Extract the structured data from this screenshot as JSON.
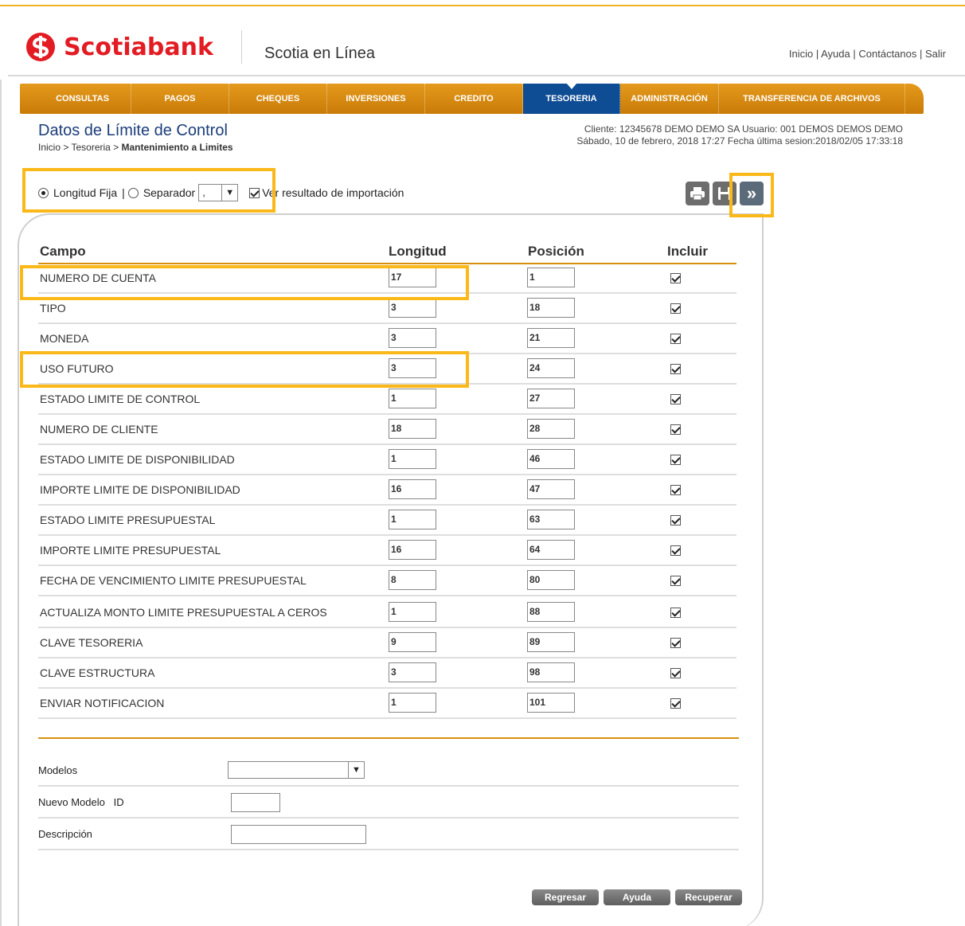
{
  "header": {
    "brand": "Scotiabank",
    "product": "Scotia en Línea",
    "links": [
      "Inicio",
      "Ayuda",
      "Contáctanos",
      "Salir"
    ]
  },
  "nav": {
    "items": [
      "CONSULTAS",
      "PAGOS",
      "CHEQUES",
      "INVERSIONES",
      "CREDITO",
      "TESORERIA",
      "ADMINISTRACIÓN",
      "TRANSFERENCIA DE ARCHIVOS"
    ],
    "active": "TESORERIA"
  },
  "page": {
    "title": "Datos de Límite de Control",
    "breadcrumb_prefix": "Inicio > Tesoreria >",
    "breadcrumb_current": "Mantenimiento a Limites"
  },
  "session": {
    "line1": "Cliente: 12345678 DEMO DEMO SA    Usuario: 001 DEMOS DEMOS DEMO",
    "line2": "Sábado, 10 de febrero, 2018 17:27    Fecha última sesion:2018/02/05 17:33:18"
  },
  "options": {
    "fixed_label": "Longitud Fija",
    "separator_label": "Separador",
    "separator_value": ",",
    "show_result_label": "Ver resultado de importación",
    "fixed_selected": true,
    "show_result_checked": true
  },
  "toolbar": {
    "icons": [
      "print-icon",
      "save-icon",
      "next-icon"
    ]
  },
  "table": {
    "columns": [
      "Campo",
      "Longitud",
      "Posición",
      "Incluir"
    ],
    "rows": [
      {
        "campo": "NUMERO DE CUENTA",
        "longitud": "17",
        "posicion": "1",
        "incluir": true
      },
      {
        "campo": "TIPO",
        "longitud": "3",
        "posicion": "18",
        "incluir": true
      },
      {
        "campo": "MONEDA",
        "longitud": "3",
        "posicion": "21",
        "incluir": true
      },
      {
        "campo": "USO FUTURO",
        "longitud": "3",
        "posicion": "24",
        "incluir": true
      },
      {
        "campo": "ESTADO LIMITE DE CONTROL",
        "longitud": "1",
        "posicion": "27",
        "incluir": true
      },
      {
        "campo": "NUMERO DE CLIENTE",
        "longitud": "18",
        "posicion": "28",
        "incluir": true
      },
      {
        "campo": "ESTADO LIMITE DE DISPONIBILIDAD",
        "longitud": "1",
        "posicion": "46",
        "incluir": true
      },
      {
        "campo": "IMPORTE LIMITE DE DISPONIBILIDAD",
        "longitud": "16",
        "posicion": "47",
        "incluir": true
      },
      {
        "campo": "ESTADO LIMITE PRESUPUESTAL",
        "longitud": "1",
        "posicion": "63",
        "incluir": true
      },
      {
        "campo": "IMPORTE LIMITE PRESUPUESTAL",
        "longitud": "16",
        "posicion": "64",
        "incluir": true
      },
      {
        "campo": "FECHA DE VENCIMIENTO LIMITE PRESUPUESTAL",
        "longitud": "8",
        "posicion": "80",
        "incluir": true
      },
      {
        "campo": "ACTUALIZA MONTO LIMITE PRESUPUESTAL A CEROS",
        "longitud": "1",
        "posicion": "88",
        "incluir": true
      },
      {
        "campo": "CLAVE TESORERIA",
        "longitud": "9",
        "posicion": "89",
        "incluir": true
      },
      {
        "campo": "CLAVE ESTRUCTURA",
        "longitud": "3",
        "posicion": "98",
        "incluir": true
      },
      {
        "campo": "ENVIAR NOTIFICACION",
        "longitud": "1",
        "posicion": "101",
        "incluir": true
      }
    ]
  },
  "form": {
    "modelos_label": "Modelos",
    "modelos_value": "",
    "nuevo_label": "Nuevo Modelo   ID",
    "nuevo_value": "",
    "descripcion_label": "Descripción",
    "descripcion_value": ""
  },
  "buttons": {
    "regresar": "Regresar",
    "ayuda": "Ayuda",
    "recuperar": "Recuperar"
  },
  "colors": {
    "brand_red": "#e31b23",
    "nav_orange": "#d4880c",
    "nav_active": "#0e4c93",
    "highlight": "#fbb919",
    "title_blue": "#1b3d7a"
  }
}
